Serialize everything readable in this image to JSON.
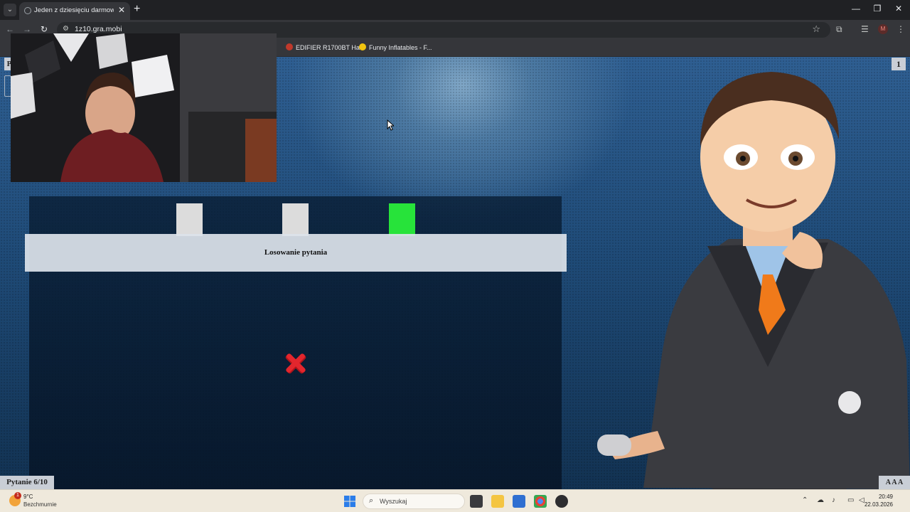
{
  "browser": {
    "tab_title": "Jeden z dziesięciu darmowa gra",
    "url": "1z10.gra.mobi",
    "bookmarks": [
      {
        "label": "EDIFIER R1700BT Ha...",
        "color": "#c0392b"
      },
      {
        "label": "Funny Inflatables - F...",
        "color": "#f1c40f"
      }
    ],
    "profile_initial": "M"
  },
  "game": {
    "top_left_label": "P",
    "counter": "1",
    "lives": [
      {
        "state": "used",
        "color": "#dcdcdc"
      },
      {
        "state": "used",
        "color": "#dcdcdc"
      },
      {
        "state": "active",
        "color": "#27e33a"
      }
    ],
    "status_text": "Losowanie pytania",
    "answer_result": "wrong",
    "question_label": "Pytanie 6/10",
    "font_size_control": "A A A"
  },
  "taskbar": {
    "weather_temp": "9°C",
    "weather_desc": "Bezchmurnie",
    "weather_badge": "1",
    "search_placeholder": "Wyszukaj",
    "time": "20:49",
    "date": "22.03.2026"
  }
}
